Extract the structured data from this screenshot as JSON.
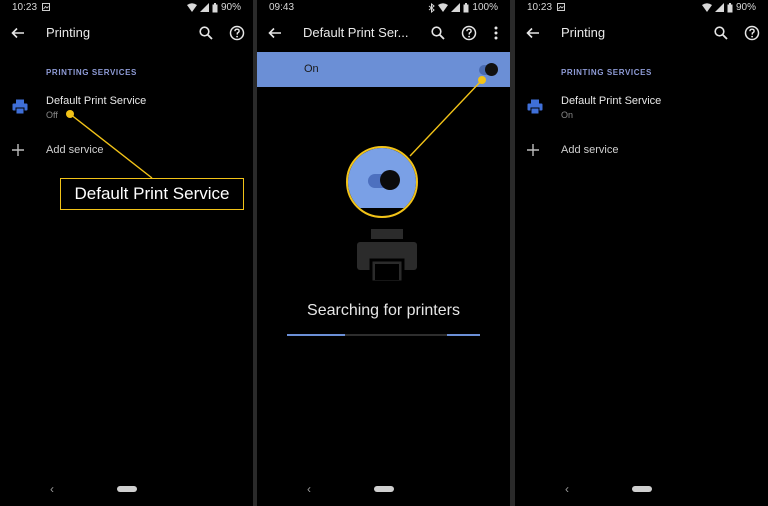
{
  "panels": [
    {
      "status": {
        "time": "10:23",
        "battery": "90%"
      },
      "appbar": {
        "title": "Printing"
      },
      "section_header": "PRINTING SERVICES",
      "service": {
        "name": "Default Print Service",
        "status": "Off"
      },
      "add_service": "Add service"
    },
    {
      "status": {
        "time": "09:43",
        "battery": "100%"
      },
      "appbar": {
        "title": "Default Print Ser..."
      },
      "switch": {
        "label": "On",
        "state": "on"
      },
      "searching": "Searching for printers"
    },
    {
      "status": {
        "time": "10:23",
        "battery": "90%"
      },
      "appbar": {
        "title": "Printing"
      },
      "section_header": "PRINTING SERVICES",
      "service": {
        "name": "Default Print Service",
        "status": "On"
      },
      "add_service": "Add service"
    }
  ],
  "callout": {
    "label": "Default Print Service"
  },
  "icons": {
    "back": "arrow-back-icon",
    "search": "search-icon",
    "help": "help-circle-icon",
    "more": "more-vertical-icon",
    "printer": "printer-icon",
    "add": "plus-icon"
  },
  "colors": {
    "accent": "#6b8fd6",
    "section_header": "#8e9bd6",
    "highlight": "#f2c318",
    "printer_icon": "#3f6fd8"
  },
  "progress": {
    "filled_fraction_left": 0.3,
    "filled_fraction_right": 0.17
  }
}
